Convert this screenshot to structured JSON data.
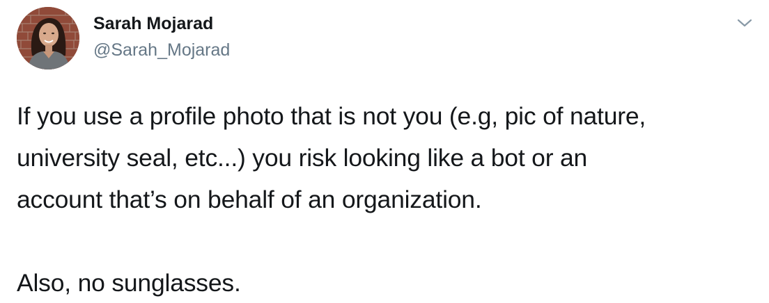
{
  "author": {
    "name": "Sarah Mojarad",
    "handle": "@Sarah_Mojarad"
  },
  "menu_icon": "chevron-down-icon",
  "tweet": {
    "lines": [
      "If you use a profile photo that is not you (e.g, pic of nature,",
      "university seal, etc...) you risk looking like a bot or an",
      "account that’s on behalf of an organization."
    ],
    "second_paragraph": "Also, no sunglasses."
  },
  "colors": {
    "text": "#14171a",
    "secondary_text": "#657786",
    "chevron": "#8899a6",
    "background": "#ffffff"
  }
}
